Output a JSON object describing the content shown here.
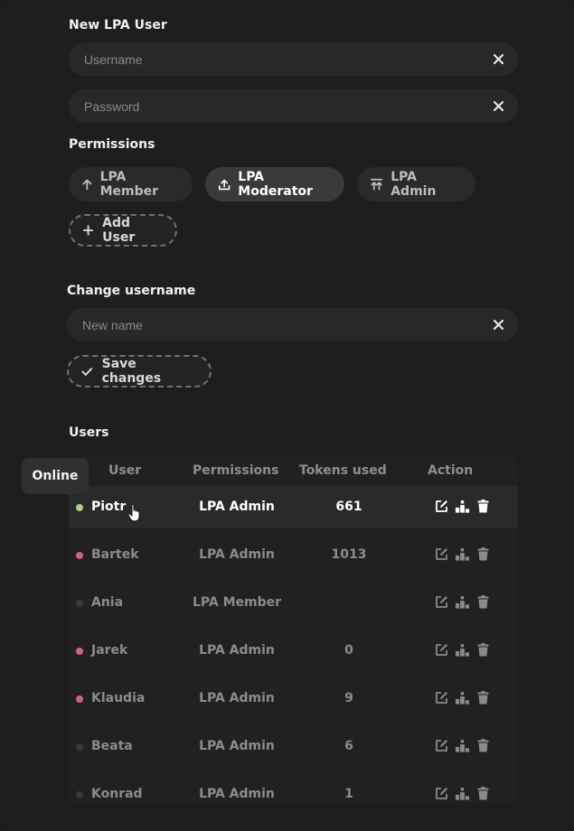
{
  "new_user": {
    "title": "New LPA User",
    "username_placeholder": "Username",
    "password_placeholder": "Password"
  },
  "permissions": {
    "title": "Permissions",
    "options": [
      {
        "label": "LPA Member",
        "icon": "arrow-up-icon",
        "selected": false
      },
      {
        "label": "LPA Moderator",
        "icon": "upload-icon",
        "selected": true
      },
      {
        "label": "LPA Admin",
        "icon": "double-arrow-up-icon",
        "selected": false
      }
    ],
    "add_label": "Add User"
  },
  "change_username": {
    "title": "Change username",
    "placeholder": "New name",
    "save_label": "Save changes"
  },
  "users": {
    "title": "Users",
    "tooltip": "Online",
    "columns": [
      "User",
      "Permissions",
      "Tokens used",
      "Action"
    ],
    "rows": [
      {
        "name": "Piotr",
        "permission": "LPA Admin",
        "tokens": "661",
        "status": "online",
        "status_color": "#a7d08c"
      },
      {
        "name": "Bartek",
        "permission": "LPA Admin",
        "tokens": "1013",
        "status": "busy",
        "status_color": "#d9607a"
      },
      {
        "name": "Ania",
        "permission": "LPA Member",
        "tokens": "",
        "status": "offline",
        "status_color": "#3a3a3a"
      },
      {
        "name": "Jarek",
        "permission": "LPA Admin",
        "tokens": "0",
        "status": "busy",
        "status_color": "#d9607a"
      },
      {
        "name": "Klaudia",
        "permission": "LPA Admin",
        "tokens": "9",
        "status": "busy",
        "status_color": "#d9607a"
      },
      {
        "name": "Beata",
        "permission": "LPA Admin",
        "tokens": "6",
        "status": "offline",
        "status_color": "#3a3a3a"
      },
      {
        "name": "Konrad",
        "permission": "LPA Admin",
        "tokens": "1",
        "status": "offline",
        "status_color": "#3a3a3a"
      }
    ]
  },
  "colors": {
    "background": "#1e1e1e",
    "field": "#282828",
    "accent_dashed": "#77735c",
    "online": "#a7d08c",
    "busy": "#d9607a",
    "offline": "#3a3a3a"
  }
}
